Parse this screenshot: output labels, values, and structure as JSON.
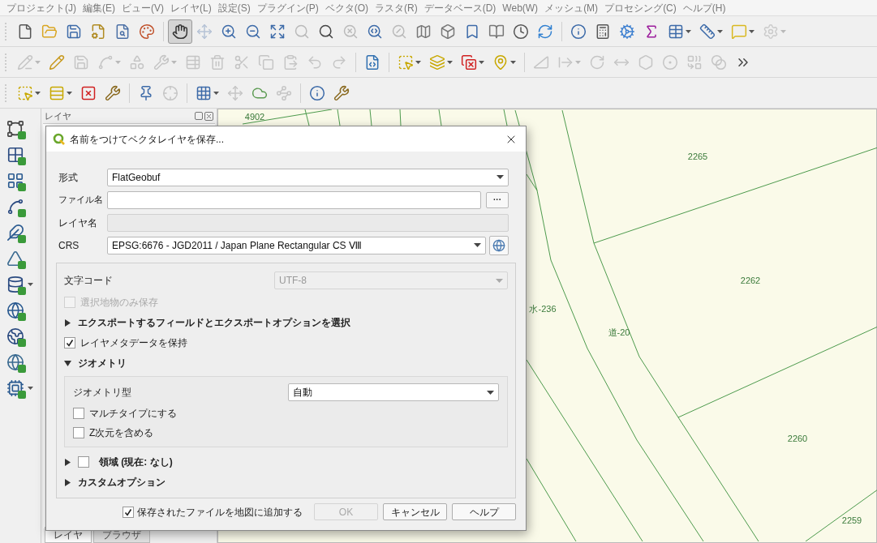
{
  "menu": [
    "プロジェクト(J)",
    "編集(E)",
    "ビュー(V)",
    "レイヤ(L)",
    "設定(S)",
    "プラグイン(P)",
    "ベクタ(O)",
    "ラスタ(R)",
    "データベース(D)",
    "Web(W)",
    "メッシュ(M)",
    "プロセシング(C)",
    "ヘルプ(H)"
  ],
  "toolbars": [
    [
      {
        "disabled": false,
        "pressed": false
      },
      {
        "disabled": false,
        "pressed": false
      },
      {
        "disabled": false,
        "pressed": false
      },
      {
        "disabled": false,
        "pressed": false
      },
      {
        "disabled": false,
        "pressed": false
      },
      {
        "disabled": false,
        "pressed": false
      },
      {
        "disabled": false,
        "pressed": true
      },
      {
        "disabled": true,
        "pressed": false
      },
      {
        "disabled": false,
        "pressed": false
      },
      {
        "disabled": false,
        "pressed": false
      },
      {
        "disabled": false,
        "pressed": false
      },
      {
        "disabled": true,
        "pressed": false
      },
      {
        "disabled": false,
        "pressed": false
      },
      {
        "disabled": true,
        "pressed": false
      },
      {
        "disabled": false,
        "pressed": false
      },
      {
        "disabled": true,
        "pressed": false
      },
      {
        "disabled": false,
        "pressed": false
      },
      {
        "disabled": false,
        "pressed": false
      },
      {
        "disabled": false,
        "pressed": false
      },
      {
        "disabled": false,
        "pressed": false
      },
      {
        "disabled": false,
        "pressed": false
      },
      {
        "disabled": false,
        "pressed": false
      },
      {
        "disabled": false,
        "pressed": false
      },
      {
        "disabled": false,
        "pressed": false
      },
      {
        "disabled": false,
        "pressed": false
      },
      {
        "disabled": false,
        "pressed": false
      },
      {
        "disabled": false,
        "pressed": false
      },
      {
        "disabled": false,
        "pressed": false
      },
      {
        "disabled": false,
        "pressed": false
      },
      {
        "disabled": true,
        "pressed": false
      }
    ],
    [
      {
        "disabled": true,
        "pressed": false
      },
      {
        "disabled": false,
        "pressed": false
      },
      {
        "disabled": true,
        "pressed": false
      },
      {
        "disabled": true,
        "pressed": false
      },
      {
        "disabled": true,
        "pressed": false
      },
      {
        "disabled": true,
        "pressed": false
      },
      {
        "disabled": true,
        "pressed": false
      },
      {
        "disabled": true,
        "pressed": false
      },
      {
        "disabled": true,
        "pressed": false
      },
      {
        "disabled": true,
        "pressed": false
      },
      {
        "disabled": true,
        "pressed": false
      },
      {
        "disabled": true,
        "pressed": false
      },
      {
        "disabled": true,
        "pressed": false
      },
      {
        "disabled": false,
        "pressed": false
      },
      {
        "disabled": false,
        "pressed": false
      },
      {
        "disabled": false,
        "pressed": false
      },
      {
        "disabled": false,
        "pressed": false
      },
      {
        "disabled": false,
        "pressed": false
      },
      {
        "disabled": true,
        "pressed": false
      },
      {
        "disabled": true,
        "pressed": false
      },
      {
        "disabled": true,
        "pressed": false
      },
      {
        "disabled": true,
        "pressed": false
      },
      {
        "disabled": true,
        "pressed": false
      },
      {
        "disabled": true,
        "pressed": false
      },
      {
        "disabled": true,
        "pressed": false
      },
      {
        "disabled": true,
        "pressed": false
      },
      {
        "disabled": false,
        "pressed": false
      }
    ],
    [
      {
        "disabled": false,
        "pressed": false
      },
      {
        "disabled": false,
        "pressed": false
      },
      {
        "disabled": false,
        "pressed": false
      },
      {
        "disabled": false,
        "pressed": false
      },
      {
        "disabled": false,
        "pressed": false
      },
      {
        "disabled": true,
        "pressed": false
      },
      {
        "disabled": false,
        "pressed": false
      },
      {
        "disabled": true,
        "pressed": false
      },
      {
        "disabled": false,
        "pressed": false
      },
      {
        "disabled": true,
        "pressed": false
      },
      {
        "disabled": false,
        "pressed": false
      },
      {
        "disabled": false,
        "pressed": false
      }
    ]
  ],
  "layers_panel": {
    "title": "レイヤ",
    "tabs": [
      {
        "label": "レイヤ",
        "selected": true
      },
      {
        "label": "ブラウザ",
        "selected": false
      }
    ]
  },
  "map": {
    "labels": [
      "4902",
      "2265",
      "2262",
      "水-236",
      "道-20",
      "2260",
      "2259"
    ]
  },
  "dialog": {
    "title": "名前をつけてベクタレイヤを保存...",
    "format": {
      "label": "形式",
      "value": "FlatGeobuf"
    },
    "file_name": {
      "label": "ファイル名",
      "browse": "···"
    },
    "layer_name": {
      "label": "レイヤ名",
      "disabled": true
    },
    "crs": {
      "label": "CRS",
      "value": "EPSG:6676 - JGD2011 / Japan Plane Rectangular CS Ⅷ"
    },
    "encoding": {
      "label": "文字コード",
      "value": "UTF-8",
      "disabled": true
    },
    "selected_only": {
      "label": "選択地物のみ保存",
      "checked": false,
      "disabled": true
    },
    "export_fields": {
      "label": "エクスポートするフィールドとエクスポートオプションを選択",
      "expanded": false
    },
    "keep_metadata": {
      "label": "レイヤメタデータを保持",
      "checked": true,
      "disabled": false
    },
    "geometry": {
      "label": "ジオメトリ",
      "expanded": true,
      "type_label": "ジオメトリ型",
      "type_value": "自動",
      "options": [
        {
          "label": "マルチタイプにする",
          "checked": false,
          "disabled": false
        },
        {
          "label": "Z次元を含める",
          "checked": false,
          "disabled": false
        }
      ]
    },
    "extent": {
      "label": "領域 (現在: なし)",
      "expanded": false,
      "checked": false
    },
    "custom_options": {
      "label": "カスタムオプション",
      "expanded": false
    },
    "add_to_map": {
      "label": "保存されたファイルを地図に追加する",
      "checked": true,
      "disabled": false
    },
    "buttons": [
      {
        "label": "OK",
        "disabled": true
      },
      {
        "label": "キャンセル",
        "disabled": false
      },
      {
        "label": "ヘルプ",
        "disabled": false
      }
    ]
  }
}
